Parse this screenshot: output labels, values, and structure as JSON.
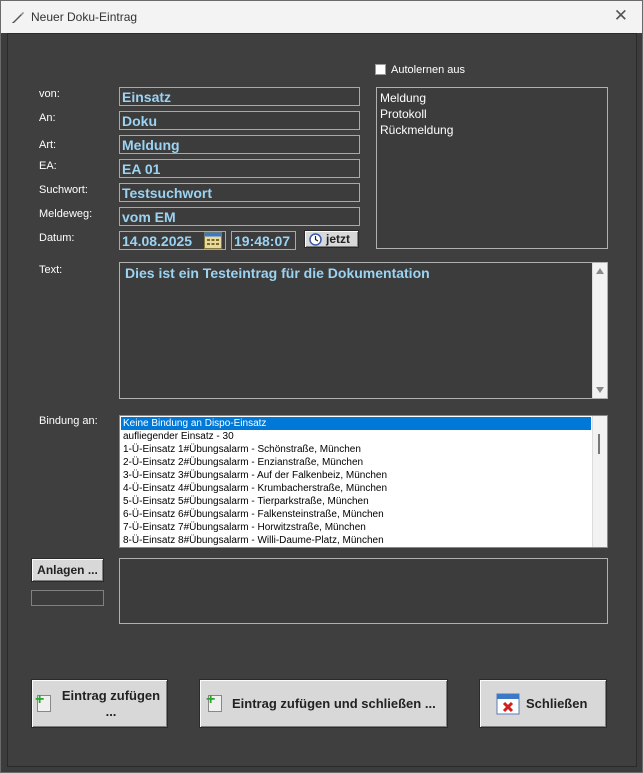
{
  "window": {
    "title": "Neuer Doku-Eintrag"
  },
  "form": {
    "von_label": "von:",
    "von_value": "Einsatz",
    "an_label": "An:",
    "an_value": "Doku",
    "art_label": "Art:",
    "art_value": "Meldung",
    "ea_label": "EA:",
    "ea_value": "EA 01",
    "suchwort_label": "Suchwort:",
    "suchwort_value": "Testsuchwort",
    "meldeweg_label": "Meldeweg:",
    "meldeweg_value": "vom EM",
    "datum_label": "Datum:",
    "date_value": "14.08.2025",
    "time_value": "19:48:07",
    "now_button": "jetzt",
    "text_label": "Text:",
    "text_value": "Dies ist ein Testeintrag für die Dokumentation",
    "bindung_label": "Bindung an:"
  },
  "autolearn": {
    "label": "Autolernen aus",
    "checked": false
  },
  "art_options": [
    "Meldung",
    "Protokoll",
    "Rückmeldung"
  ],
  "bindung_items": [
    "Keine Bindung an Dispo-Einsatz",
    "aufliegender Einsatz - 30",
    "1-Ü-Einsatz 1#Übungsalarm - Schönstraße, München",
    "2-Ü-Einsatz 2#Übungsalarm - Enzianstraße, München",
    "3-Ü-Einsatz 3#Übungsalarm - Auf der Falkenbeiz, München",
    "4-Ü-Einsatz 4#Übungsalarm - Krumbacherstraße, München",
    "5-Ü-Einsatz 5#Übungsalarm - Tierparkstraße, München",
    "6-Ü-Einsatz 6#Übungsalarm - Falkensteinstraße, München",
    "7-Ü-Einsatz 7#Übungsalarm - Horwitzstraße, München",
    "8-Ü-Einsatz 8#Übungsalarm - Willi-Daume-Platz, München"
  ],
  "anlagen": {
    "button": "Anlagen ..."
  },
  "buttons": {
    "add": "Eintrag zufügen ...",
    "add_close": "Eintrag zufügen und schließen ...",
    "close": "Schließen"
  }
}
